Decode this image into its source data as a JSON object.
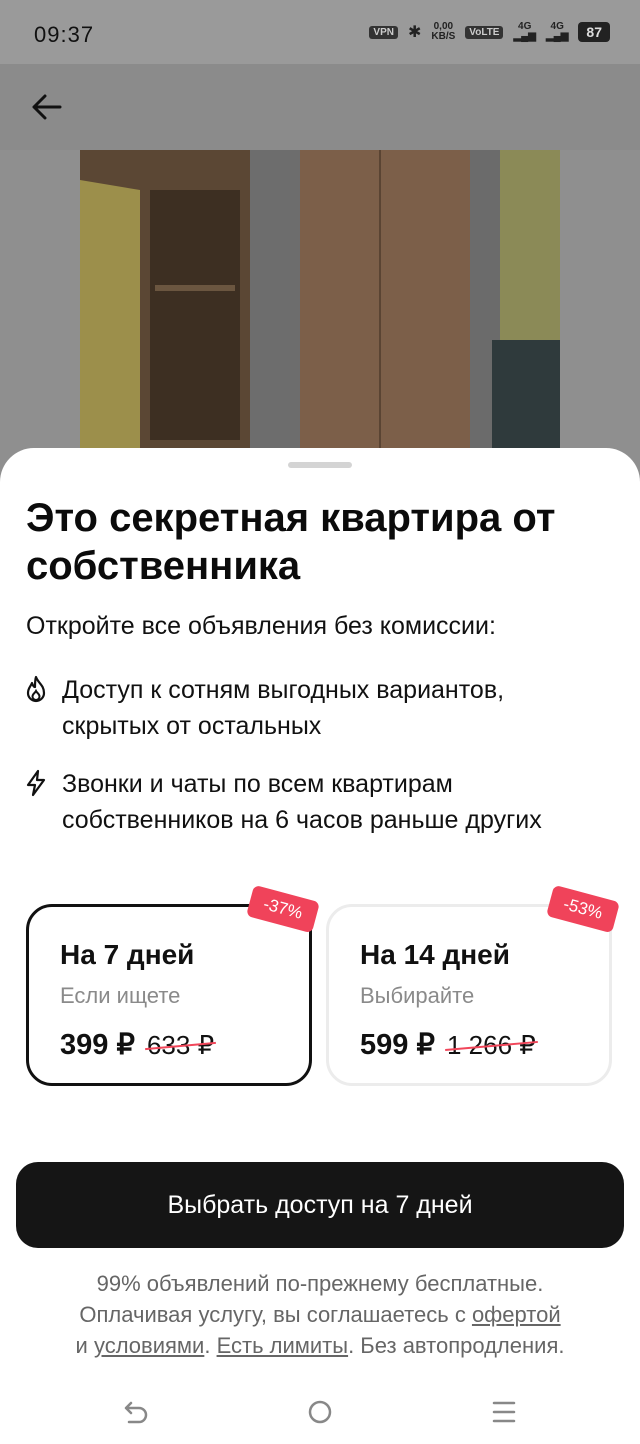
{
  "status_bar": {
    "time": "09:37",
    "vpn": "VPN",
    "speed_value": "0,00",
    "speed_unit": "KB/S",
    "volte": "VoLTE",
    "net1": "4G",
    "net2": "4G",
    "battery": "87"
  },
  "header": {
    "back_icon": "arrow-left-icon"
  },
  "sheet": {
    "title": "Это секретная квартира от собственника",
    "subtitle": "Откройте все объявления без комиссии:",
    "features": [
      {
        "icon": "flame-icon",
        "text": "Доступ к сотням выгодных вариантов, скрытых от остальных"
      },
      {
        "icon": "lightning-icon",
        "text": "Звонки и чаты по всем квартирам собственников на 6 часов раньше других"
      }
    ],
    "plans": [
      {
        "title": "На 7 дней",
        "subtitle": "Если ищете",
        "price": "399 ₽",
        "old_price": "633 ₽",
        "discount": "-37%",
        "selected": true
      },
      {
        "title": "На 14 дней",
        "subtitle": "Выбирайте",
        "price": "599 ₽",
        "old_price": "1 266 ₽",
        "discount": "-53%",
        "selected": false
      }
    ],
    "cta_label": "Выбрать доступ на 7 дней",
    "legal": {
      "line1": "99% объявлений по-прежнему бесплатные.",
      "line2_prefix": "Оплачивая услугу, вы соглашаетесь с ",
      "offer_link": "офертой",
      "and": "и ",
      "terms_link": "условиями",
      "dot": ". ",
      "limits_link": "Есть лимиты",
      "suffix": ". Без автопродления."
    }
  },
  "nav": {
    "back_icon": "nav-back-icon",
    "home_icon": "nav-home-icon",
    "menu_icon": "nav-menu-icon"
  },
  "colors": {
    "accent_red": "#f0435a",
    "cta_bg": "#151515"
  }
}
